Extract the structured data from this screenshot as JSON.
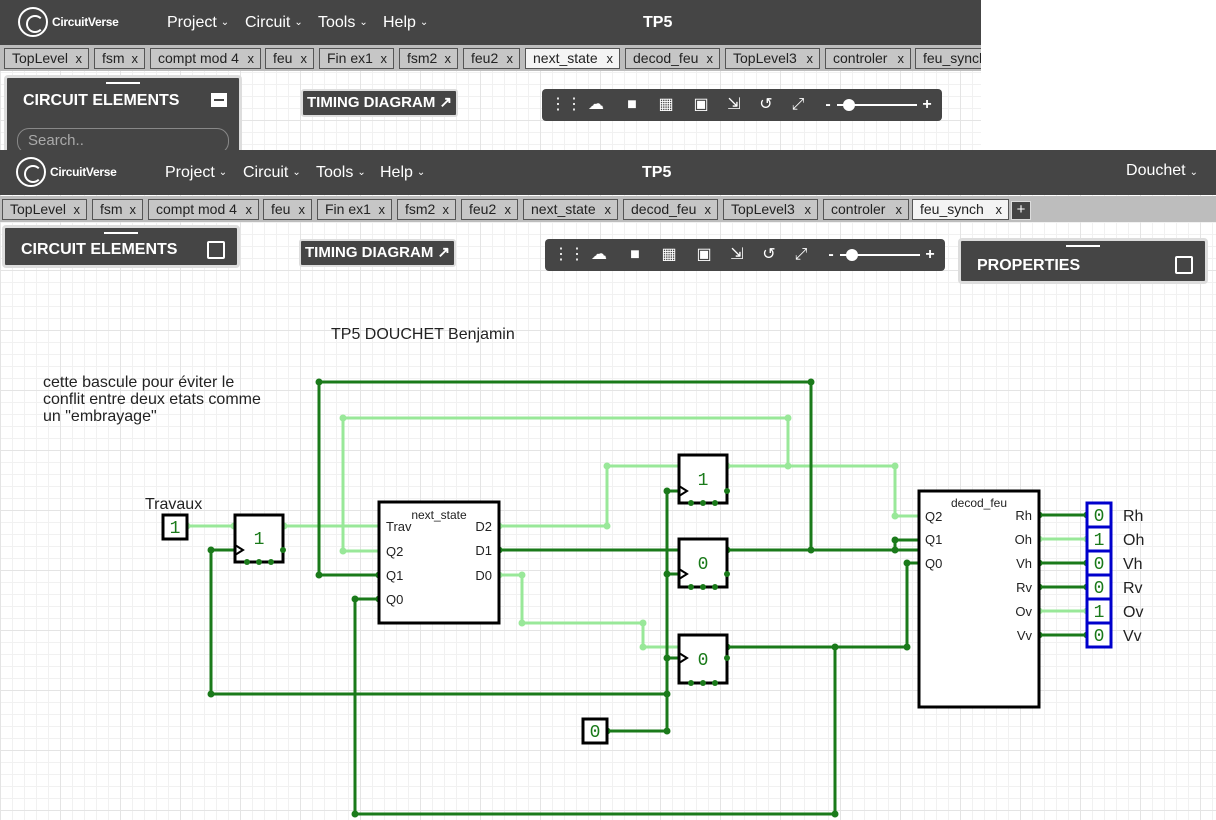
{
  "brand": {
    "logo_text": "CircuitVerse"
  },
  "navbar": {
    "menus": [
      "Project",
      "Circuit",
      "Tools",
      "Help"
    ],
    "project_title": "TP5",
    "user": "Douchet"
  },
  "tabs_back": [
    "TopLevel",
    "fsm",
    "compt mod 4",
    "feu",
    "Fin ex1",
    "fsm2",
    "feu2",
    "next_state",
    "decod_feu",
    "TopLevel3",
    "controler",
    "feu_synch"
  ],
  "tabs_front": [
    "TopLevel",
    "fsm",
    "compt mod 4",
    "feu",
    "Fin ex1",
    "fsm2",
    "feu2",
    "next_state",
    "decod_feu",
    "TopLevel3",
    "controler",
    "feu_synch"
  ],
  "tab_close": "x",
  "add_tab": "+",
  "panels": {
    "circuit_elements": "CIRCUIT ELEMENTS",
    "search_placeholder": "Search..",
    "timing_diagram": "TIMING DIAGRAM",
    "properties": "PROPERTIES"
  },
  "toolbar": {
    "icons": [
      "drag-handle-icon",
      "cloud-upload-icon",
      "save-icon",
      "clear-icon",
      "image-icon",
      "fit-icon",
      "undo-icon",
      "fullscreen-icon"
    ],
    "zoom_out": "-",
    "zoom_in": "+",
    "zoom_level": 0.15
  },
  "canvas": {
    "title_text": "TP5 DOUCHET Benjamin",
    "comment_lines": [
      "cette bascule pour éviter le",
      "conflit entre deux etats  comme",
      "un \"embrayage\""
    ],
    "input_label": "Travaux",
    "input_value": "1",
    "const_value": "0",
    "flipflop_values": [
      "1",
      "1",
      "0",
      "0"
    ],
    "next_state": {
      "name": "next_state",
      "inputs": [
        "Trav",
        "Q2",
        "Q1",
        "Q0"
      ],
      "outputs": [
        "D2",
        "D1",
        "D0"
      ]
    },
    "decod_feu": {
      "name": "decod_feu",
      "inputs": [
        "Q2",
        "Q1",
        "Q0"
      ],
      "outputs": [
        "Rh",
        "Oh",
        "Vh",
        "Rv",
        "Ov",
        "Vv"
      ]
    },
    "outputs": [
      {
        "label": "Rh",
        "value": "0"
      },
      {
        "label": "Oh",
        "value": "1"
      },
      {
        "label": "Vh",
        "value": "0"
      },
      {
        "label": "Rv",
        "value": "0"
      },
      {
        "label": "Ov",
        "value": "1"
      },
      {
        "label": "Vv",
        "value": "0"
      }
    ]
  },
  "colors": {
    "navbar": "#454545",
    "wire_dark": "#1a7a1a",
    "wire_light": "#99e899",
    "output_border": "#0000cc"
  }
}
